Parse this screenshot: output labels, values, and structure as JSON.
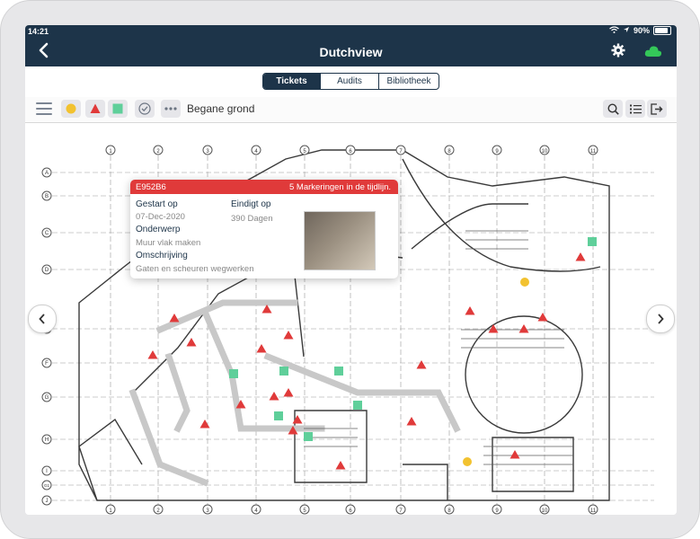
{
  "statusbar": {
    "time": "14:21",
    "battery": "90%"
  },
  "header": {
    "title": "Dutchview",
    "back_icon": "chevron-left-icon",
    "settings_icon": "gear-icon",
    "sync_icon": "cloud-icon",
    "sync_color": "#34c759"
  },
  "tabs": [
    {
      "label": "Tickets",
      "active": true
    },
    {
      "label": "Audits",
      "active": false
    },
    {
      "label": "Bibliotheek",
      "active": false
    }
  ],
  "toolbar": {
    "floor_label": "Begane grond",
    "filters": [
      {
        "icon": "circle-icon",
        "color": "#f2c230"
      },
      {
        "icon": "triangle-icon",
        "color": "#e03a3a"
      },
      {
        "icon": "square-icon",
        "color": "#5fcf9a"
      }
    ],
    "check_icon": "check-circle-icon",
    "more_icon": "more-icon",
    "search_icon": "search-icon",
    "list_icon": "list-icon",
    "export_icon": "export-icon"
  },
  "popup": {
    "id": "E952B6",
    "message": "5 Markeringen in de tijdlijn.",
    "start_label": "Gestart op",
    "start_value": "07-Dec-2020",
    "end_label": "Eindigt op",
    "end_value": "390 Dagen",
    "subject_label": "Onderwerp",
    "subject_value": "Muur vlak maken",
    "description_label": "Omschrijving",
    "description_value": "Gaten en scheuren wegwerken"
  },
  "plan": {
    "grid_cols": [
      "1",
      "2",
      "3",
      "4",
      "5",
      "6",
      "7",
      "8",
      "9",
      "10",
      "11"
    ],
    "grid_rows": [
      "A",
      "B",
      "C",
      "D",
      "E",
      "F",
      "G",
      "H",
      "I",
      "G1",
      "J"
    ]
  }
}
